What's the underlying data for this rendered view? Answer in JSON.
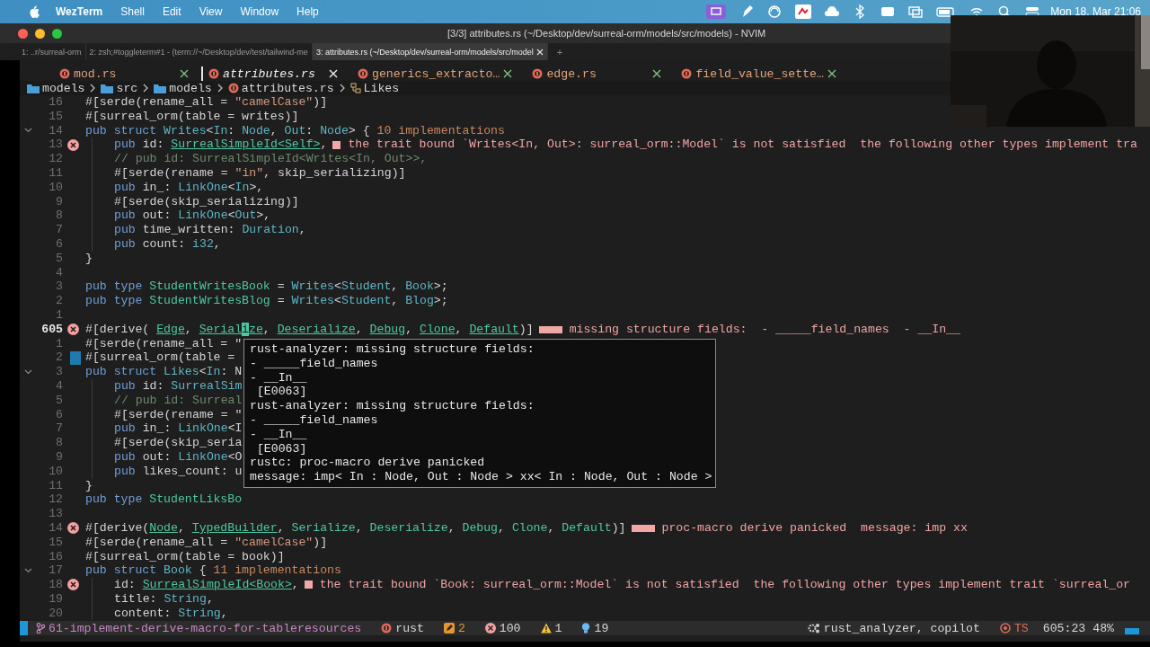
{
  "menu_bar": {
    "app": "WezTerm",
    "items": [
      "Shell",
      "Edit",
      "View",
      "Window",
      "Help"
    ],
    "clock": "Mon 18. Mar 21:06"
  },
  "window": {
    "title": "[3/3] attributes.rs (~/Desktop/dev/surreal-orm/models/src/models) - NVIM"
  },
  "terminal_tabs": [
    {
      "label": "1: ..r/surreal-orm",
      "selected": false,
      "closable": false
    },
    {
      "label": "2: zsh;#toggleterm#1 - (term://~/Desktop/dev/test/tailwind-me",
      "selected": false,
      "closable": false
    },
    {
      "label": "3: attributes.rs (~/Desktop/dev/surreal-orm/models/src/model",
      "selected": true,
      "closable": true
    }
  ],
  "new_tab": "+",
  "buffer_tabs": [
    {
      "label": "mod.rs",
      "selected": false
    },
    {
      "label": "attributes.rs",
      "selected": true
    },
    {
      "label": "generics_extracto…",
      "selected": false
    },
    {
      "label": "edge.rs",
      "selected": false
    },
    {
      "label": "field_value_sette…",
      "selected": false
    }
  ],
  "breadcrumb": [
    {
      "kind": "folder",
      "label": "models"
    },
    {
      "kind": "folder",
      "label": "src"
    },
    {
      "kind": "folder",
      "label": "models"
    },
    {
      "kind": "file",
      "label": "attributes.rs"
    },
    {
      "kind": "struct",
      "label": "Likes"
    }
  ],
  "lines": [
    {
      "number": "16",
      "current": false,
      "error": false,
      "fold": false,
      "indent": false,
      "marked": false,
      "tokens": [
        {
          "kind": "plain",
          "text": "#[serde(rename_all = "
        },
        {
          "kind": "str",
          "text": "\"camelCase\""
        },
        {
          "kind": "plain",
          "text": ")]"
        }
      ]
    },
    {
      "number": "15",
      "current": false,
      "error": false,
      "fold": false,
      "indent": false,
      "marked": false,
      "tokens": [
        {
          "kind": "plain",
          "text": "#[surreal_orm(table = writes)]"
        }
      ]
    },
    {
      "number": "14",
      "current": false,
      "error": false,
      "fold": true,
      "indent": false,
      "marked": false,
      "tokens": [
        {
          "kind": "kw",
          "text": "pub struct "
        },
        {
          "kind": "ty",
          "text": "Writes"
        },
        {
          "kind": "plain",
          "text": "<"
        },
        {
          "kind": "ty",
          "text": "In"
        },
        {
          "kind": "plain",
          "text": ": "
        },
        {
          "kind": "ty",
          "text": "Node"
        },
        {
          "kind": "plain",
          "text": ", "
        },
        {
          "kind": "ty",
          "text": "Out"
        },
        {
          "kind": "plain",
          "text": ": "
        },
        {
          "kind": "ty",
          "text": "Node"
        },
        {
          "kind": "plain",
          "text": "> { "
        },
        {
          "kind": "hint",
          "text": "10 implementations"
        }
      ]
    },
    {
      "number": "13",
      "current": false,
      "error": true,
      "fold": false,
      "indent": true,
      "marked": false,
      "tokens": [
        {
          "kind": "kw",
          "text": "pub "
        },
        {
          "kind": "plain",
          "text": "id: "
        },
        {
          "kind": "link",
          "text": "SurrealSimpleId<Self>"
        },
        {
          "kind": "plain",
          "text": ","
        }
      ],
      "diagnostic": {
        "text": "the trait bound `Writes<In, Out>: surreal_orm::Model` is not satisfied  the following other types implement tra",
        "wide": false
      }
    },
    {
      "number": "12",
      "current": false,
      "error": false,
      "fold": false,
      "indent": true,
      "marked": false,
      "tokens": [
        {
          "kind": "comment",
          "text": "// pub id: SurrealSimpleId<Writes<In, Out>>,"
        }
      ]
    },
    {
      "number": "11",
      "current": false,
      "error": false,
      "fold": false,
      "indent": true,
      "marked": false,
      "tokens": [
        {
          "kind": "plain",
          "text": "#[serde(rename = "
        },
        {
          "kind": "str",
          "text": "\"in\""
        },
        {
          "kind": "plain",
          "text": ", skip_serializing)]"
        }
      ]
    },
    {
      "number": "10",
      "current": false,
      "error": false,
      "fold": false,
      "indent": true,
      "marked": false,
      "tokens": [
        {
          "kind": "kw",
          "text": "pub "
        },
        {
          "kind": "plain",
          "text": "in_: "
        },
        {
          "kind": "ty",
          "text": "LinkOne"
        },
        {
          "kind": "plain",
          "text": "<"
        },
        {
          "kind": "ty",
          "text": "In"
        },
        {
          "kind": "plain",
          "text": ">,"
        }
      ]
    },
    {
      "number": "9",
      "current": false,
      "error": false,
      "fold": false,
      "indent": true,
      "marked": false,
      "tokens": [
        {
          "kind": "plain",
          "text": "#[serde(skip_serializing)]"
        }
      ]
    },
    {
      "number": "8",
      "current": false,
      "error": false,
      "fold": false,
      "indent": true,
      "marked": false,
      "tokens": [
        {
          "kind": "kw",
          "text": "pub "
        },
        {
          "kind": "plain",
          "text": "out: "
        },
        {
          "kind": "ty",
          "text": "LinkOne"
        },
        {
          "kind": "plain",
          "text": "<"
        },
        {
          "kind": "ty",
          "text": "Out"
        },
        {
          "kind": "plain",
          "text": ">,"
        }
      ]
    },
    {
      "number": "7",
      "current": false,
      "error": false,
      "fold": false,
      "indent": true,
      "marked": false,
      "tokens": [
        {
          "kind": "kw",
          "text": "pub "
        },
        {
          "kind": "plain",
          "text": "time_written: "
        },
        {
          "kind": "ty",
          "text": "Duration"
        },
        {
          "kind": "plain",
          "text": ","
        }
      ]
    },
    {
      "number": "6",
      "current": false,
      "error": false,
      "fold": false,
      "indent": true,
      "marked": false,
      "tokens": [
        {
          "kind": "kw",
          "text": "pub "
        },
        {
          "kind": "plain",
          "text": "count: "
        },
        {
          "kind": "ty",
          "text": "i32"
        },
        {
          "kind": "plain",
          "text": ","
        }
      ]
    },
    {
      "number": "5",
      "current": false,
      "error": false,
      "fold": false,
      "indent": false,
      "marked": false,
      "tokens": [
        {
          "kind": "plain",
          "text": "}"
        }
      ]
    },
    {
      "number": "4",
      "current": false,
      "error": false,
      "fold": false,
      "indent": false,
      "marked": false
    },
    {
      "number": "3",
      "current": false,
      "error": false,
      "fold": false,
      "indent": false,
      "marked": false,
      "tokens": [
        {
          "kind": "kw",
          "text": "pub type "
        },
        {
          "kind": "name",
          "text": "StudentWritesBook"
        },
        {
          "kind": "plain",
          "text": " = "
        },
        {
          "kind": "ty",
          "text": "Writes"
        },
        {
          "kind": "plain",
          "text": "<"
        },
        {
          "kind": "ty",
          "text": "Student"
        },
        {
          "kind": "plain",
          "text": ", "
        },
        {
          "kind": "ty",
          "text": "Book"
        },
        {
          "kind": "plain",
          "text": ">;"
        }
      ]
    },
    {
      "number": "2",
      "current": false,
      "error": false,
      "fold": false,
      "indent": false,
      "marked": false,
      "tokens": [
        {
          "kind": "kw",
          "text": "pub type "
        },
        {
          "kind": "name",
          "text": "StudentWritesBlog"
        },
        {
          "kind": "plain",
          "text": " = "
        },
        {
          "kind": "ty",
          "text": "Writes"
        },
        {
          "kind": "plain",
          "text": "<"
        },
        {
          "kind": "ty",
          "text": "Student"
        },
        {
          "kind": "plain",
          "text": ", "
        },
        {
          "kind": "ty",
          "text": "Blog"
        },
        {
          "kind": "plain",
          "text": ">;"
        }
      ]
    },
    {
      "number": "1",
      "current": false,
      "error": false,
      "fold": false,
      "indent": false,
      "marked": false
    },
    {
      "number": "605",
      "current": true,
      "error": true,
      "fold": false,
      "indent": false,
      "marked": false,
      "tokens": [
        {
          "kind": "plain",
          "text": "#[derive( "
        },
        {
          "kind": "link",
          "text": "Edge"
        },
        {
          "kind": "plain",
          "text": ", "
        },
        {
          "kind": "link",
          "text": "Serial"
        },
        {
          "kind": "cursor",
          "text": "i"
        },
        {
          "kind": "link",
          "text": "ze"
        },
        {
          "kind": "plain",
          "text": ", "
        },
        {
          "kind": "link",
          "text": "Deserialize"
        },
        {
          "kind": "plain",
          "text": ", "
        },
        {
          "kind": "link",
          "text": "Debug"
        },
        {
          "kind": "plain",
          "text": ", "
        },
        {
          "kind": "link",
          "text": "Clone"
        },
        {
          "kind": "plain",
          "text": ", "
        },
        {
          "kind": "link",
          "text": "Default"
        },
        {
          "kind": "plain",
          "text": ")]"
        }
      ],
      "diagnostic": {
        "text": "missing structure fields:  - _____field_names  - __In__",
        "wide": true
      }
    },
    {
      "number": "1",
      "current": false,
      "error": false,
      "fold": false,
      "indent": false,
      "marked": false,
      "tokens": [
        {
          "kind": "plain",
          "text": "#[serde(rename_all = \""
        }
      ]
    },
    {
      "number": "2",
      "current": false,
      "error": false,
      "fold": false,
      "indent": false,
      "marked": true,
      "tokens": [
        {
          "kind": "plain",
          "text": "#[surreal_orm(table = "
        }
      ]
    },
    {
      "number": "3",
      "current": false,
      "error": false,
      "fold": true,
      "indent": false,
      "marked": false,
      "tokens": [
        {
          "kind": "kw",
          "text": "pub struct "
        },
        {
          "kind": "ty",
          "text": "Likes"
        },
        {
          "kind": "plain",
          "text": "<"
        },
        {
          "kind": "ty",
          "text": "In"
        },
        {
          "kind": "plain",
          "text": ": N"
        }
      ]
    },
    {
      "number": "4",
      "current": false,
      "error": false,
      "fold": false,
      "indent": true,
      "marked": false,
      "tokens": [
        {
          "kind": "kw",
          "text": "pub "
        },
        {
          "kind": "plain",
          "text": "id: "
        },
        {
          "kind": "ty",
          "text": "SurrealSim"
        }
      ]
    },
    {
      "number": "5",
      "current": false,
      "error": false,
      "fold": false,
      "indent": true,
      "marked": false,
      "tokens": [
        {
          "kind": "comment",
          "text": "// pub id: Surreal"
        }
      ]
    },
    {
      "number": "6",
      "current": false,
      "error": false,
      "fold": false,
      "indent": true,
      "marked": false,
      "tokens": [
        {
          "kind": "plain",
          "text": "#[serde(rename = \""
        }
      ]
    },
    {
      "number": "7",
      "current": false,
      "error": false,
      "fold": false,
      "indent": true,
      "marked": false,
      "tokens": [
        {
          "kind": "kw",
          "text": "pub "
        },
        {
          "kind": "plain",
          "text": "in_: "
        },
        {
          "kind": "ty",
          "text": "LinkOne"
        },
        {
          "kind": "plain",
          "text": "<I"
        }
      ]
    },
    {
      "number": "8",
      "current": false,
      "error": false,
      "fold": false,
      "indent": true,
      "marked": false,
      "tokens": [
        {
          "kind": "plain",
          "text": "#[serde(skip_seria"
        }
      ]
    },
    {
      "number": "9",
      "current": false,
      "error": false,
      "fold": false,
      "indent": true,
      "marked": false,
      "tokens": [
        {
          "kind": "kw",
          "text": "pub "
        },
        {
          "kind": "plain",
          "text": "out: "
        },
        {
          "kind": "ty",
          "text": "LinkOne"
        },
        {
          "kind": "plain",
          "text": "<O"
        }
      ]
    },
    {
      "number": "10",
      "current": false,
      "error": false,
      "fold": false,
      "indent": true,
      "marked": false,
      "tokens": [
        {
          "kind": "kw",
          "text": "pub "
        },
        {
          "kind": "plain",
          "text": "likes_count: u"
        }
      ]
    },
    {
      "number": "11",
      "current": false,
      "error": false,
      "fold": false,
      "indent": false,
      "marked": false,
      "tokens": [
        {
          "kind": "plain",
          "text": "}"
        }
      ]
    },
    {
      "number": "12",
      "current": false,
      "error": false,
      "fold": false,
      "indent": false,
      "marked": false,
      "tokens": [
        {
          "kind": "kw",
          "text": "pub type "
        },
        {
          "kind": "name",
          "text": "StudentLiksBo"
        }
      ]
    },
    {
      "number": "13",
      "current": false,
      "error": false,
      "fold": false,
      "indent": false,
      "marked": false
    },
    {
      "number": "14",
      "current": false,
      "error": true,
      "fold": false,
      "indent": false,
      "marked": false,
      "tokens": [
        {
          "kind": "plain",
          "text": "#[derive("
        },
        {
          "kind": "link",
          "text": "Node"
        },
        {
          "kind": "plain",
          "text": ", "
        },
        {
          "kind": "link",
          "text": "TypedBuilder"
        },
        {
          "kind": "plain",
          "text": ", "
        },
        {
          "kind": "name",
          "text": "Serialize"
        },
        {
          "kind": "plain",
          "text": ", "
        },
        {
          "kind": "name",
          "text": "Deserialize"
        },
        {
          "kind": "plain",
          "text": ", "
        },
        {
          "kind": "name",
          "text": "Debug"
        },
        {
          "kind": "plain",
          "text": ", "
        },
        {
          "kind": "name",
          "text": "Clone"
        },
        {
          "kind": "plain",
          "text": ", "
        },
        {
          "kind": "name",
          "text": "Default"
        },
        {
          "kind": "plain",
          "text": ")]"
        }
      ],
      "diagnostic": {
        "text": "proc-macro derive panicked  message: imp xx",
        "wide": true
      }
    },
    {
      "number": "15",
      "current": false,
      "error": false,
      "fold": false,
      "indent": false,
      "marked": false,
      "tokens": [
        {
          "kind": "plain",
          "text": "#[serde(rename_all = "
        },
        {
          "kind": "str",
          "text": "\"camelCase\""
        },
        {
          "kind": "plain",
          "text": ")]"
        }
      ]
    },
    {
      "number": "16",
      "current": false,
      "error": false,
      "fold": false,
      "indent": false,
      "marked": false,
      "tokens": [
        {
          "kind": "plain",
          "text": "#[surreal_orm(table = book)]"
        }
      ]
    },
    {
      "number": "17",
      "current": false,
      "error": false,
      "fold": true,
      "indent": false,
      "marked": false,
      "tokens": [
        {
          "kind": "kw",
          "text": "pub struct "
        },
        {
          "kind": "ty",
          "text": "Book"
        },
        {
          "kind": "plain",
          "text": " { "
        },
        {
          "kind": "hint",
          "text": "11 implementations"
        }
      ]
    },
    {
      "number": "18",
      "current": false,
      "error": true,
      "fold": false,
      "indent": true,
      "marked": false,
      "tokens": [
        {
          "kind": "plain",
          "text": "id: "
        },
        {
          "kind": "link",
          "text": "SurrealSimpleId<Book>"
        },
        {
          "kind": "plain",
          "text": ","
        }
      ],
      "diagnostic": {
        "text": "the trait bound `Book: surreal_orm::Model` is not satisfied  the following other types implement trait `surreal_or",
        "wide": false
      }
    },
    {
      "number": "19",
      "current": false,
      "error": false,
      "fold": false,
      "indent": true,
      "marked": false,
      "tokens": [
        {
          "kind": "plain",
          "text": "title: "
        },
        {
          "kind": "ty",
          "text": "String"
        },
        {
          "kind": "plain",
          "text": ","
        }
      ]
    },
    {
      "number": "20",
      "current": false,
      "error": false,
      "fold": false,
      "indent": true,
      "marked": false,
      "tokens": [
        {
          "kind": "plain",
          "text": "content: "
        },
        {
          "kind": "ty",
          "text": "String"
        },
        {
          "kind": "plain",
          "text": ","
        }
      ]
    }
  ],
  "hover_popup": {
    "lines": [
      "rust-analyzer: missing structure fields:",
      "- _____field_names",
      "- __In__",
      " [E0063]",
      "rust-analyzer: missing structure fields:",
      "- _____field_names",
      "- __In__",
      " [E0063]",
      "rustc: proc-macro derive panicked",
      "message: imp< In : Node, Out : Node > xx< In : Node, Out : Node >"
    ]
  },
  "status_bar": {
    "branch": "61-implement-derive-macro-for-tableresources",
    "filetype": "rust",
    "changes": "2",
    "errors": "100",
    "warnings": "1",
    "hints": "19",
    "lsp": "rust_analyzer, copilot",
    "treesitter": "TS",
    "position": "605:23",
    "progress": "48%"
  }
}
